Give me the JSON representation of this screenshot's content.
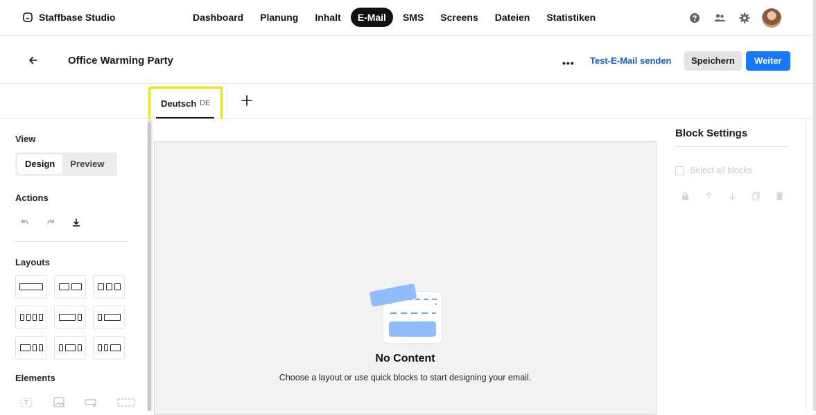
{
  "brand": {
    "name": "Staffbase Studio"
  },
  "nav": {
    "items": [
      {
        "label": "Dashboard",
        "active": false
      },
      {
        "label": "Planung",
        "active": false
      },
      {
        "label": "Inhalt",
        "active": false
      },
      {
        "label": "E-Mail",
        "active": true
      },
      {
        "label": "SMS",
        "active": false
      },
      {
        "label": "Screens",
        "active": false
      },
      {
        "label": "Dateien",
        "active": false
      },
      {
        "label": "Statistiken",
        "active": false
      }
    ],
    "right_icons": [
      "help-icon",
      "users-icon",
      "gear-icon"
    ]
  },
  "header": {
    "title": "Office Warming Party",
    "more_label": "•••",
    "test_email_label": "Test-E-Mail senden",
    "save_label": "Speichern",
    "next_label": "Weiter"
  },
  "language": {
    "tab_label": "Deutsch",
    "tab_code": "DE",
    "highlight_color": "#f2e600"
  },
  "sidebar": {
    "view_heading": "View",
    "view_options": [
      {
        "label": "Design",
        "active": true
      },
      {
        "label": "Preview",
        "active": false
      }
    ],
    "actions_heading": "Actions",
    "actions": [
      "undo-icon",
      "redo-icon",
      "download-icon"
    ],
    "layouts_heading": "Layouts",
    "elements_heading": "Elements"
  },
  "canvas": {
    "empty_title": "No Content",
    "empty_description": "Choose a layout or use quick blocks to start designing your email."
  },
  "block_settings": {
    "title": "Block Settings",
    "select_all_label": "Select all blocks",
    "icons": [
      "lock-icon",
      "arrow-up-icon",
      "arrow-down-icon",
      "copy-icon",
      "trash-icon"
    ]
  },
  "colors": {
    "accent": "#1677ff",
    "link": "#0a63c9",
    "illustration": "#8fbcfb"
  }
}
